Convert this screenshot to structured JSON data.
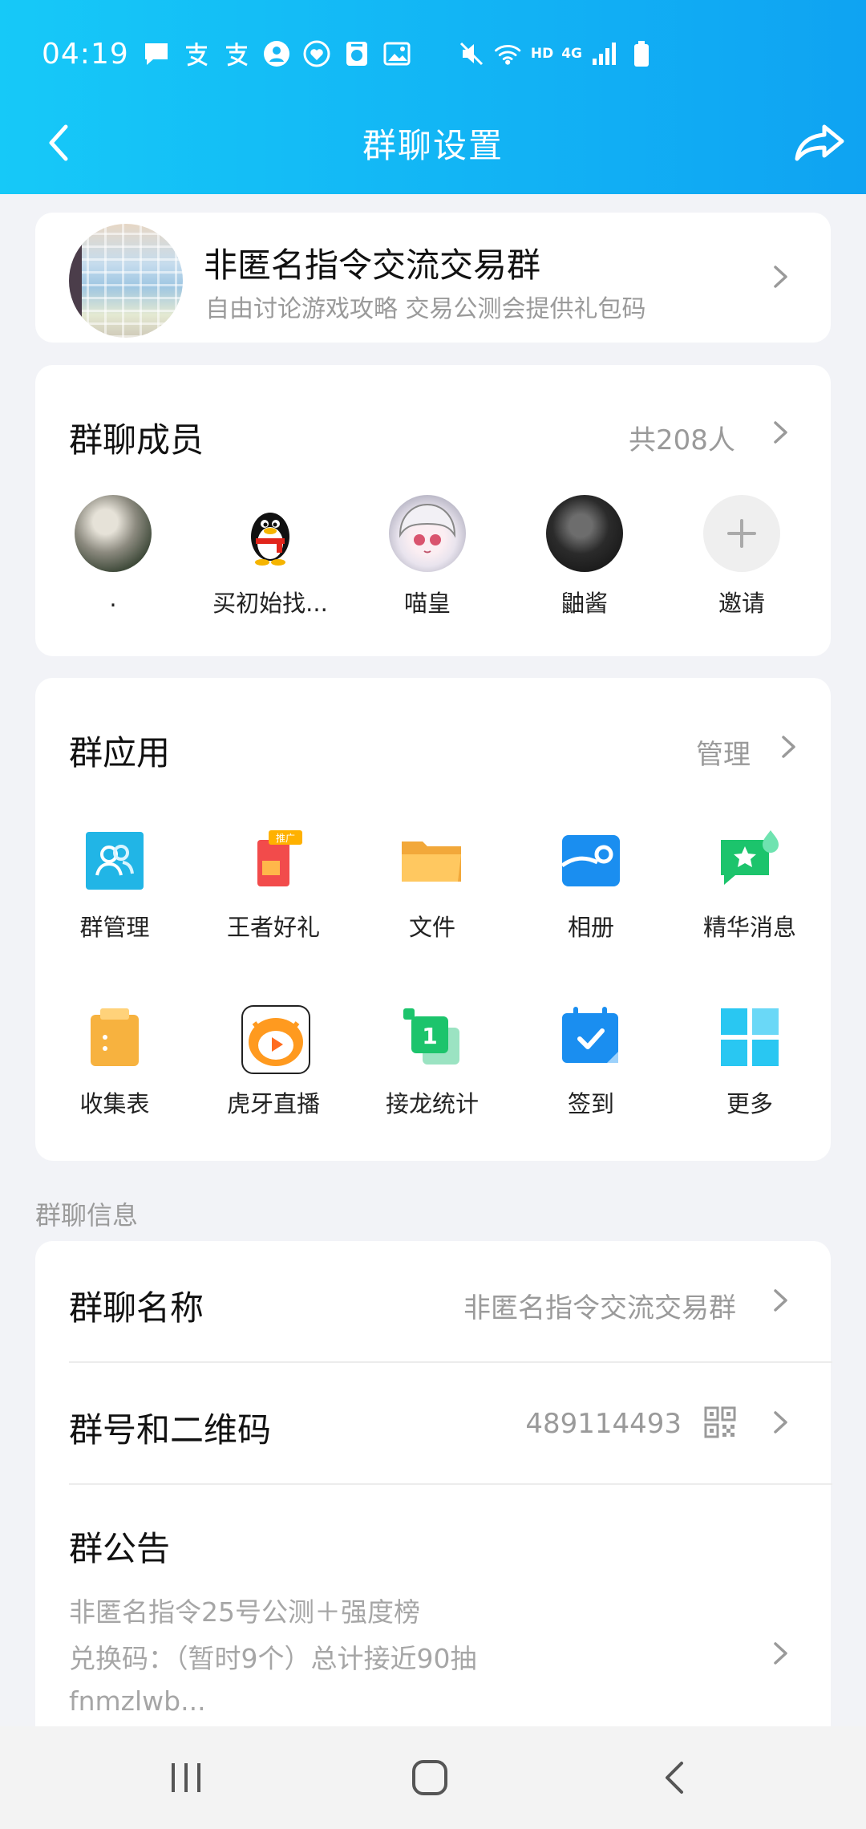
{
  "status_bar": {
    "time": "04:19",
    "network_label": "HD",
    "signal_label": "4G",
    "icons": [
      "message-icon",
      "alipay-icon",
      "alipay-icon",
      "person-icon",
      "heart-icon",
      "camera-icon",
      "image-icon",
      "mute-icon",
      "wifi-icon",
      "signal-icon",
      "battery-icon"
    ]
  },
  "nav": {
    "title": "群聊设置",
    "back_icon": "back-arrow-icon",
    "share_icon": "share-icon"
  },
  "group": {
    "name": "非匿名指令交流交易群",
    "description": "自由讨论游戏攻略 交易公测会提供礼包码"
  },
  "members": {
    "title": "群聊成员",
    "count": "共208人",
    "list": [
      {
        "name": "."
      },
      {
        "name": "买初始找..."
      },
      {
        "name": "喵皇"
      },
      {
        "name": "鼬酱"
      },
      {
        "name": "邀请"
      }
    ]
  },
  "apps": {
    "title": "群应用",
    "manage": "管理",
    "items": [
      {
        "label": "群管理",
        "icon": "group-manage-icon"
      },
      {
        "label": "王者好礼",
        "icon": "gift-icon",
        "badge": "推广"
      },
      {
        "label": "文件",
        "icon": "folder-icon"
      },
      {
        "label": "相册",
        "icon": "album-icon"
      },
      {
        "label": "精华消息",
        "icon": "essence-message-icon"
      },
      {
        "label": "收集表",
        "icon": "clipboard-icon"
      },
      {
        "label": "虎牙直播",
        "icon": "huya-icon"
      },
      {
        "label": "接龙统计",
        "icon": "chain-count-icon"
      },
      {
        "label": "签到",
        "icon": "checkin-calendar-icon"
      },
      {
        "label": "更多",
        "icon": "more-grid-icon"
      }
    ]
  },
  "info": {
    "section_label": "群聊信息",
    "name_title": "群聊名称",
    "name_value": "非匿名指令交流交易群",
    "number_title": "群号和二维码",
    "number_value": "489114493",
    "notice_title": "群公告",
    "notice_lines": [
      "非匿名指令25号公测＋强度榜",
      "兑换码：（暂时9个）总计接近90抽",
      "fnmzlwb..."
    ]
  },
  "colors": {
    "header_start": "#16c9f8",
    "header_end": "#0fa3f2",
    "background": "#f2f3f7",
    "muted_text": "#9a9a9a"
  }
}
